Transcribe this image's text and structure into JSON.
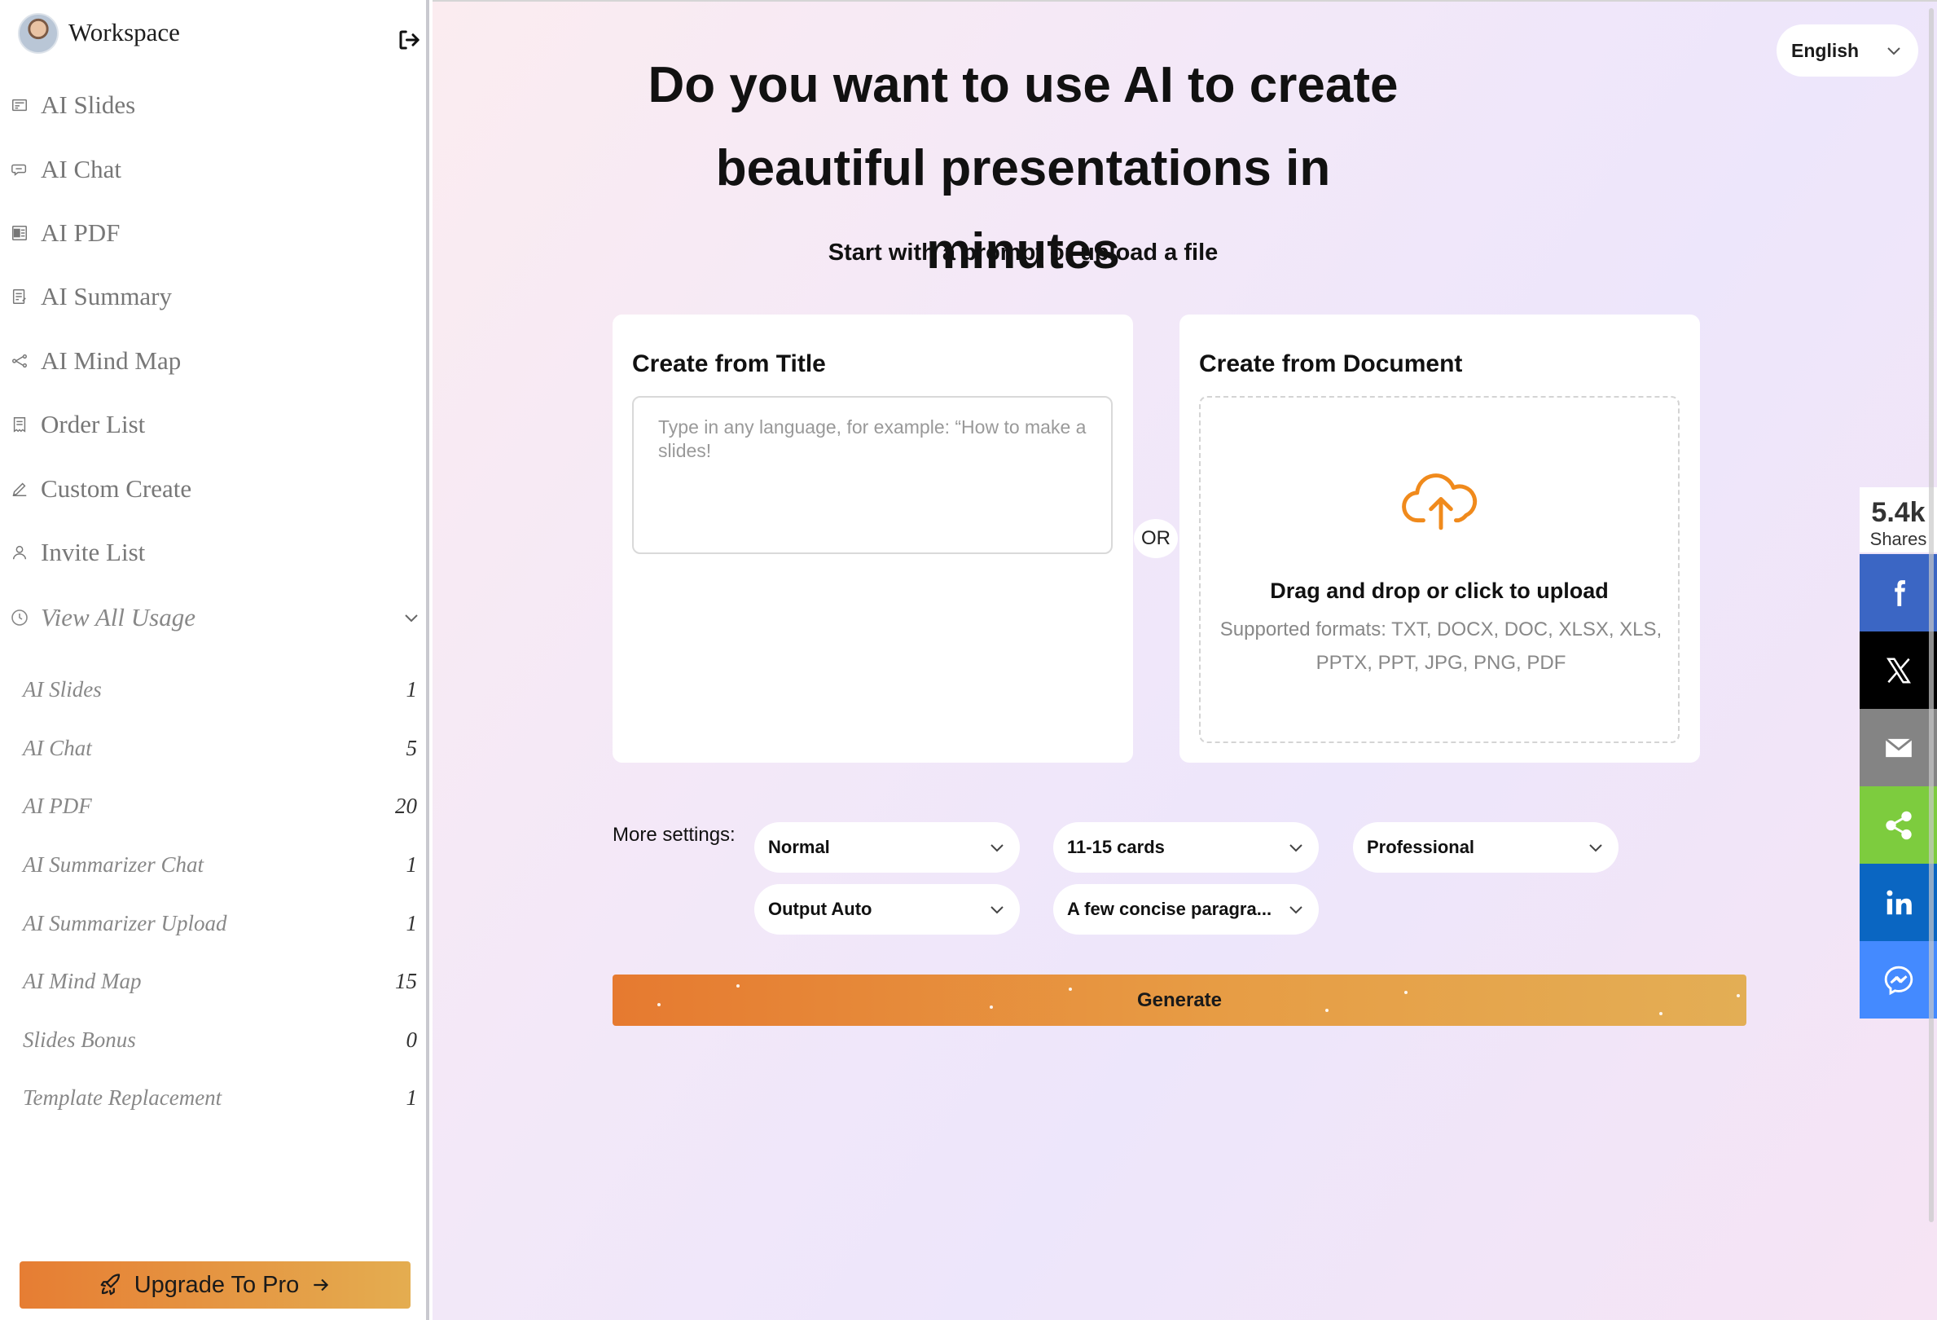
{
  "sidebar": {
    "workspace_title": "Workspace",
    "nav": [
      {
        "label": "AI Slides",
        "icon": "slides-icon"
      },
      {
        "label": "AI Chat",
        "icon": "chat-icon"
      },
      {
        "label": "AI PDF",
        "icon": "pdf-icon"
      },
      {
        "label": "AI Summary",
        "icon": "summary-icon"
      },
      {
        "label": "AI Mind Map",
        "icon": "mind-map-icon"
      },
      {
        "label": "Order List",
        "icon": "order-list-icon"
      },
      {
        "label": "Custom Create",
        "icon": "pen-icon"
      },
      {
        "label": "Invite List",
        "icon": "user-icon"
      }
    ],
    "usage_header": "View All Usage",
    "usage": [
      {
        "label": "AI Slides",
        "count": "1"
      },
      {
        "label": "AI Chat",
        "count": "5"
      },
      {
        "label": "AI PDF",
        "count": "20"
      },
      {
        "label": "AI Summarizer Chat",
        "count": "1"
      },
      {
        "label": "AI Summarizer Upload",
        "count": "1"
      },
      {
        "label": "AI Mind Map",
        "count": "15"
      },
      {
        "label": "Slides Bonus",
        "count": "0"
      },
      {
        "label": "Template Replacement",
        "count": "1"
      }
    ],
    "upgrade_label": "Upgrade To Pro"
  },
  "main": {
    "language": "English",
    "title": "Do you want to use AI to create beautiful presentations in minutes",
    "subtitle": "Start with a prompt or upload a file",
    "title_card": {
      "heading": "Create from Title",
      "placeholder": "Type in any language, for example: “How to make a slides!"
    },
    "or_label": "OR",
    "document_card": {
      "heading": "Create from Document",
      "upload_title": "Drag and drop or click to upload",
      "formats": "Supported formats: TXT, DOCX, DOC, XLSX, XLS, PPTX, PPT, JPG, PNG, PDF"
    },
    "settings": {
      "label": "More settings:",
      "tone": "Normal",
      "cards": "11-15 cards",
      "style": "Professional",
      "output": "Output Auto",
      "text_amount": "A few concise paragra..."
    },
    "generate_label": "Generate"
  },
  "share": {
    "count": "5.4k",
    "label": "Shares",
    "colors": {
      "facebook": "#3b66c4",
      "x": "#000000",
      "email": "#848484",
      "share": "#7dcc3e",
      "linkedin": "#0a66c2",
      "messenger": "#448aff"
    }
  }
}
